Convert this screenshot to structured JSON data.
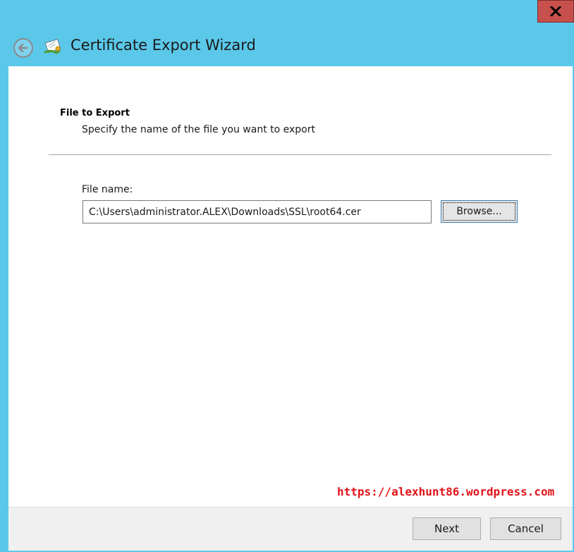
{
  "window": {
    "title": "Certificate Export Wizard",
    "close_label": "X"
  },
  "section": {
    "title": "File to Export",
    "description": "Specify the name of the file you want to export"
  },
  "file": {
    "label": "File name:",
    "value": "C:\\Users\\administrator.ALEX\\Downloads\\SSL\\root64.cer",
    "browse_label": "Browse..."
  },
  "footer": {
    "next_label": "Next",
    "cancel_label": "Cancel"
  },
  "watermark": "https://alexhunt86.wordpress.com",
  "icons": {
    "back": "back-arrow-icon",
    "wizard": "certificate-icon",
    "close": "close-icon"
  },
  "colors": {
    "titlebar": "#5bc8ea",
    "close": "#c7504c",
    "watermark": "#e0131a"
  }
}
